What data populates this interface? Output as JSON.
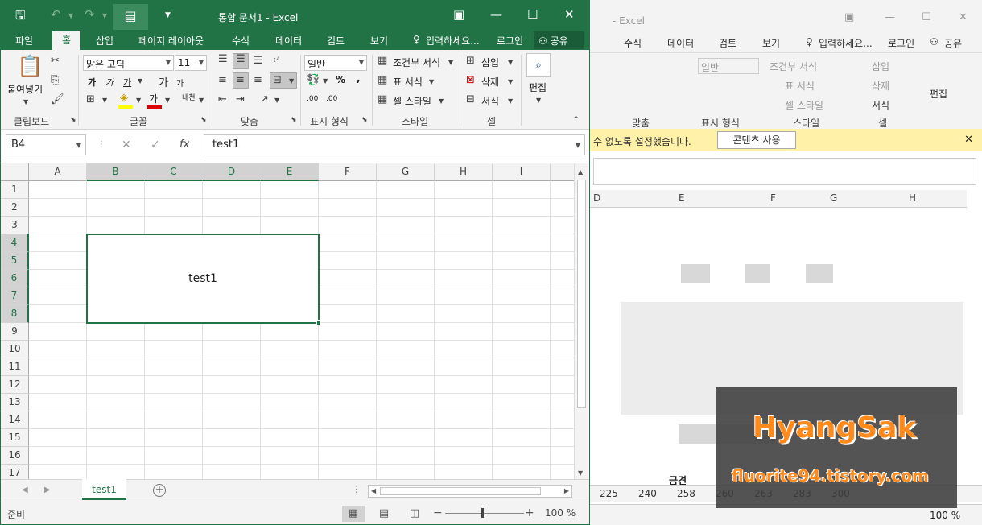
{
  "foreground": {
    "title": "통합 문서1 - Excel",
    "tabs": [
      "파일",
      "홈",
      "삽입",
      "페이지 레이아웃",
      "수식",
      "데이터",
      "검토",
      "보기"
    ],
    "tell_me": "입력하세요...",
    "login": "로그인",
    "share": "공유",
    "ribbon": {
      "paste": "붙여넣기",
      "font_name": "맑은 고딕",
      "font_size": "11",
      "number_format": "일반",
      "conditional": "조건부 서식",
      "table_format": "표 서식",
      "cell_style": "셀 스타일",
      "insert": "삽입",
      "delete": "삭제",
      "format": "서식",
      "edit": "편집",
      "group_labels": {
        "clipboard": "클립보드",
        "font": "글꼴",
        "alignment": "맞춤",
        "number": "표시 형식",
        "styles": "스타일",
        "cells": "셀"
      },
      "font_buttons": {
        "bold": "가",
        "italic": "가",
        "underline": "가",
        "grow": "가",
        "shrink": "가",
        "color": "가",
        "phonetic": "내천"
      },
      "number_buttons": {
        "percent": "%",
        "comma": ",",
        "inc_decimal": ".00",
        "dec_decimal": ".00"
      }
    },
    "name_box": "B4",
    "formula_value": "test1",
    "fx": "fx",
    "columns": [
      "A",
      "B",
      "C",
      "D",
      "E",
      "F",
      "G",
      "H",
      "I"
    ],
    "rows": [
      "1",
      "2",
      "3",
      "4",
      "5",
      "6",
      "7",
      "8",
      "9",
      "10",
      "11",
      "12",
      "13",
      "14",
      "15",
      "16",
      "17"
    ],
    "merged_cell_value": "test1",
    "sheet_tab": "test1",
    "add_sheet": "+",
    "status": "준비",
    "zoom": "100 %",
    "accent": "#217346"
  },
  "background": {
    "title": "- Excel",
    "tabs": [
      "수식",
      "데이터",
      "검토",
      "보기"
    ],
    "tell_me": "입력하세요...",
    "login": "로그인",
    "share": "공유",
    "ribbon": {
      "number_format": "일반",
      "conditional": "조건부 서식",
      "table_format": "표 서식",
      "cell_style": "셀 스타일",
      "insert": "삽입",
      "delete": "삭제",
      "format": "서식",
      "edit": "편집",
      "labels": [
        "맞춤",
        "표시 형식",
        "스타일",
        "셀"
      ]
    },
    "warning_text": "수 없도록 설정했습니다.",
    "warning_button": "콘텐츠 사용",
    "columns": [
      "D",
      "E",
      "F",
      "G",
      "H"
    ],
    "cell_text": "금견",
    "sheet_tabs": [
      "225",
      "240",
      "258",
      "260",
      "263",
      "283",
      "300"
    ],
    "zoom": "100 %"
  },
  "watermark": {
    "line1": "HyangSak",
    "line2": "fluorite94.tistory.com"
  }
}
